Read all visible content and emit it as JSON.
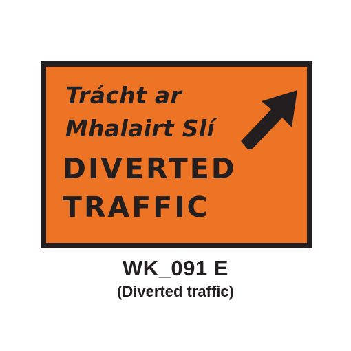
{
  "sign": {
    "irish_line_1": "Trácht ar",
    "irish_line_2": "Mhalairt Slí",
    "english_line_1": "DIVERTED",
    "english_line_2": "TRAFFIC",
    "arrow_icon": "arrow-up-right-icon",
    "background_color": "#ed7425",
    "border_color": "#231f20"
  },
  "caption": {
    "code": "WK_091 E",
    "description": "(Diverted traffic)"
  }
}
